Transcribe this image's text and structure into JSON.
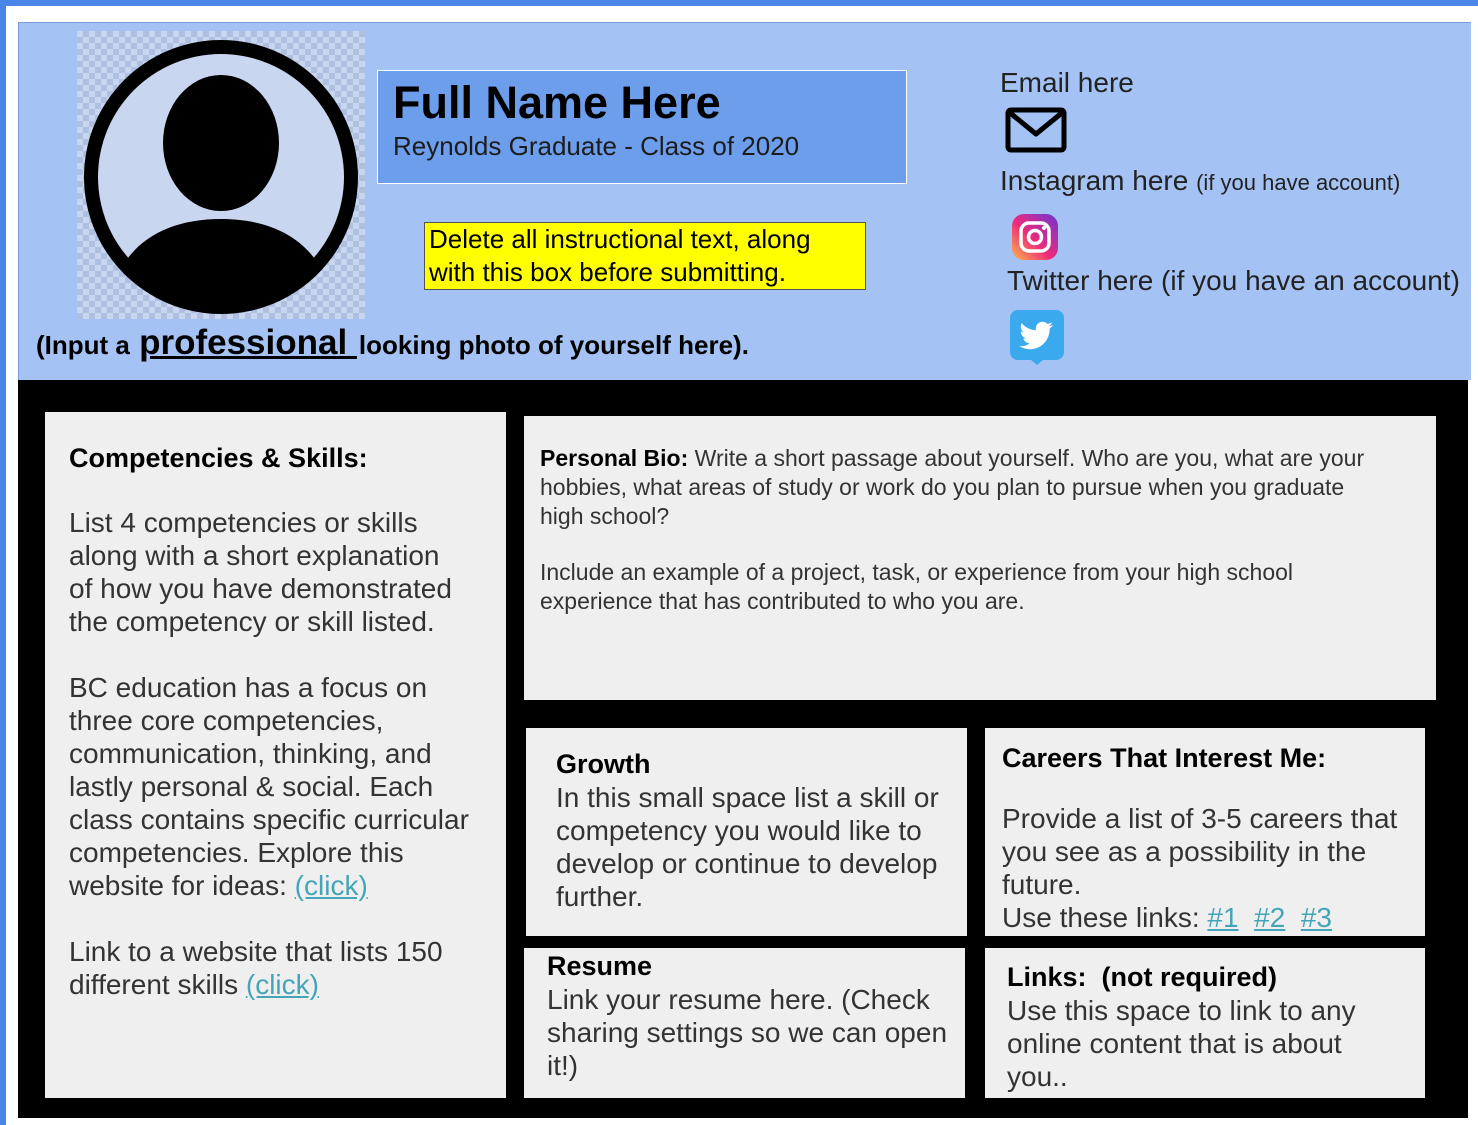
{
  "header": {
    "name": "Full Name Here",
    "subtitle": "Reynolds Graduate - Class of 2020",
    "instruction": "Delete all instructional text, along with this box before submitting.",
    "photo_caption_pre": "(Input a ",
    "photo_caption_emph": "professional ",
    "photo_caption_post": "looking photo of yourself here).",
    "email": "Email here",
    "instagram": "Instagram here ",
    "instagram_note": "(if you have account)",
    "twitter": "Twitter here (if you have an account)"
  },
  "icons": {
    "avatar": "person-silhouette-icon",
    "email": "envelope-icon",
    "instagram": "instagram-icon",
    "twitter": "twitter-bird-icon"
  },
  "colors": {
    "page_border": "#4a86e8",
    "header_bg": "#a4c2f4",
    "name_box_bg": "#6d9eeb",
    "instruction_bg": "#ffff00",
    "panel_bg": "#efefef",
    "link": "#45a5b8"
  },
  "competencies": {
    "heading": "Competencies & Skills:",
    "para1": "List 4 competencies or skills along with a short explanation of how you have demonstrated the competency or skill listed.",
    "para2": "BC  education has a focus on three core competencies, communication, thinking, and lastly personal & social. Each class contains specific curricular competencies. Explore this website for ideas: ",
    "para2_link": "(click)",
    "para3": "Link to a website that lists 150 different skills ",
    "para3_link": "(click)"
  },
  "bio": {
    "heading": "Personal Bio:",
    "text1": " Write a short passage about yourself.  Who are you, what are your hobbies, what areas of study or work do you plan to pursue when you graduate high school?",
    "text2": "Include an example of a project, task, or experience from your high school experience that has contributed to who you are."
  },
  "growth": {
    "heading": "Growth",
    "text": "In this small space list a skill or competency you would like to develop or continue to develop further."
  },
  "careers": {
    "heading": "Careers That Interest Me:",
    "text": "Provide a list of 3-5 careers that you see as a possibility in the future.",
    "links_label": "Use these links: ",
    "link1": "#1",
    "link2": "#2",
    "link3": "#3"
  },
  "resume": {
    "heading": "Resume",
    "text": "Link your resume here. (Check sharing settings so we can open it!)"
  },
  "links": {
    "heading": "Links:  (not required)",
    "text": "Use this space to link to any online content that is about you.."
  }
}
